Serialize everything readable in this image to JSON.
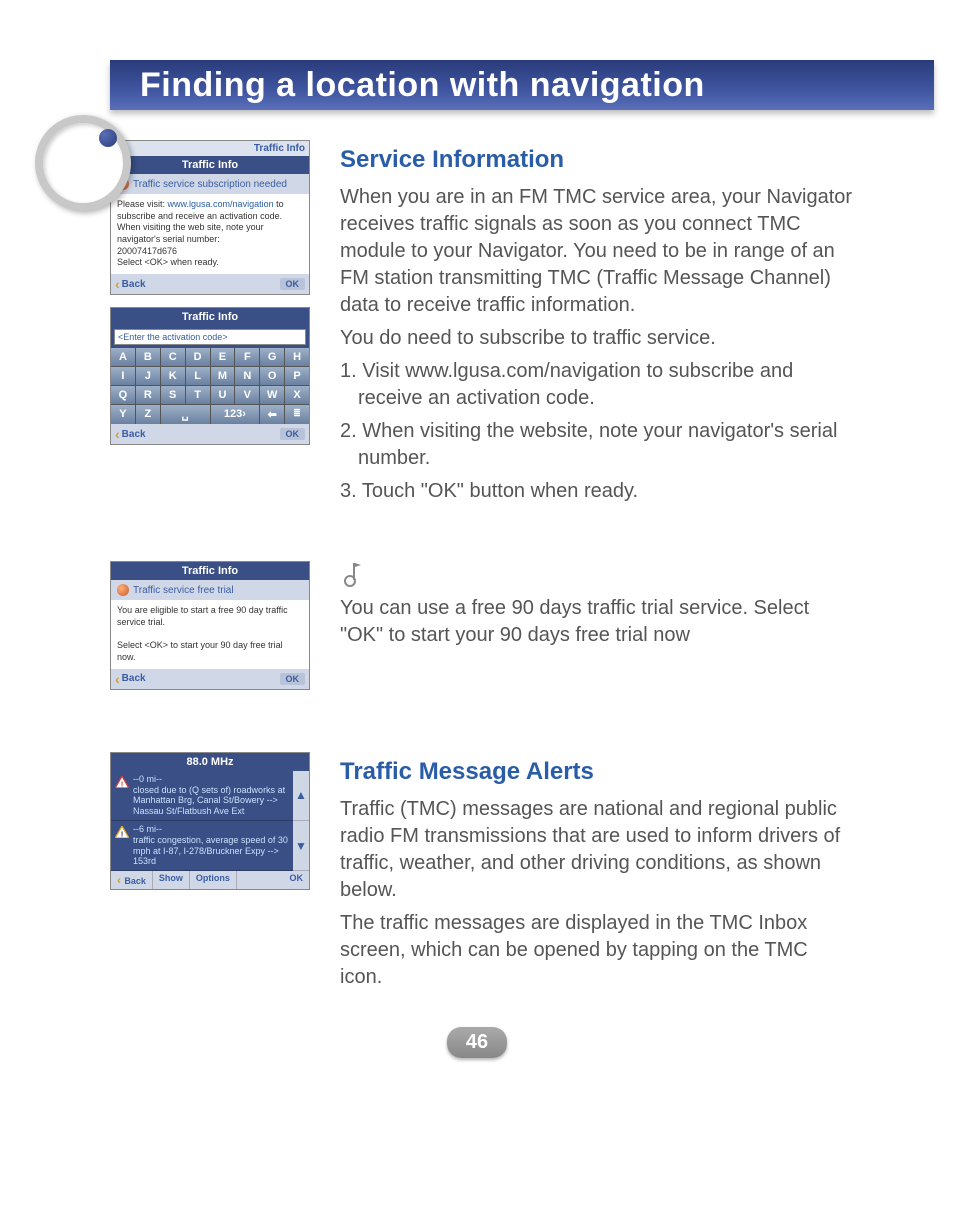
{
  "header": {
    "title": "Finding a location with navigation"
  },
  "page_number": "46",
  "screens": {
    "sub_needed": {
      "topbar": "Traffic Info",
      "header": "Traffic Info",
      "banner": "Traffic service subscription needed",
      "body_prefix": "Please visit: ",
      "body_link": "www.lgusa.com/navigation",
      "body_rest": " to subscribe and receive an activation code. When visiting the web site, note your navigator's serial number:",
      "serial": "20007417d676",
      "select_line": "Select <OK> when ready.",
      "back": "Back",
      "ok": "OK"
    },
    "keyboard": {
      "header": "Traffic Info",
      "placeholder": "<Enter the activation code>",
      "keys_row1": [
        "A",
        "B",
        "C",
        "D",
        "E",
        "F",
        "G",
        "H"
      ],
      "keys_row2": [
        "I",
        "J",
        "K",
        "L",
        "M",
        "N",
        "O",
        "P"
      ],
      "keys_row3": [
        "Q",
        "R",
        "S",
        "T",
        "U",
        "V",
        "W",
        "X"
      ],
      "keys_row4": [
        "Y",
        "Z"
      ],
      "space": "␣",
      "mode": "123›",
      "backspace": "⬅",
      "list": "≣",
      "back": "Back",
      "ok": "OK"
    },
    "free_trial": {
      "header": "Traffic Info",
      "banner": "Traffic service free trial",
      "line1": "You are eligible to start a free 90 day traffic service trial.",
      "line2": "Select <OK> to start your 90 day free trial now.",
      "back": "Back",
      "ok": "OK"
    },
    "tmc_inbox": {
      "header": "88.0 MHz",
      "item1_dist": "--0 mi--",
      "item1_text": "closed due to (Q sets of) roadworks at Manhattan Brg, Canal St/Bowery --> Nassau St/Flatbush Ave Ext",
      "item2_dist": "--6 mi--",
      "item2_text": "traffic congestion, average speed of 30 mph at I-87, I-278/Bruckner Expy --> 153rd",
      "back": "Back",
      "show": "Show",
      "options": "Options",
      "ok": "OK"
    }
  },
  "service_info": {
    "heading": "Service Information",
    "p1": "When you are in an FM TMC service area, your Navigator receives traffic signals as soon as you connect TMC module to your Navigator. You need to be in range of an FM station transmitting TMC (Traffic Message Channel) data to receive traffic information.",
    "p2": "You do need to subscribe to traffic service.",
    "li1": "1. Visit www.lgusa.com/navigation to subscribe and receive an activation code.",
    "li2": "2. When visiting the website, note your navigator's serial number.",
    "li3": "3. Touch \"OK\" button when ready."
  },
  "trial_note": {
    "text": "You can use a free 90 days traffic trial service. Select \"OK\" to start your 90 days free trial now"
  },
  "tmc_alerts": {
    "heading": "Traffic Message Alerts",
    "p1": "Traffic (TMC) messages are national and regional public radio FM transmissions that are used to inform drivers of traffic, weather, and other driving conditions, as shown below.",
    "p2": "The traffic messages are displayed in the TMC Inbox screen, which can be opened by tapping on the TMC icon."
  }
}
